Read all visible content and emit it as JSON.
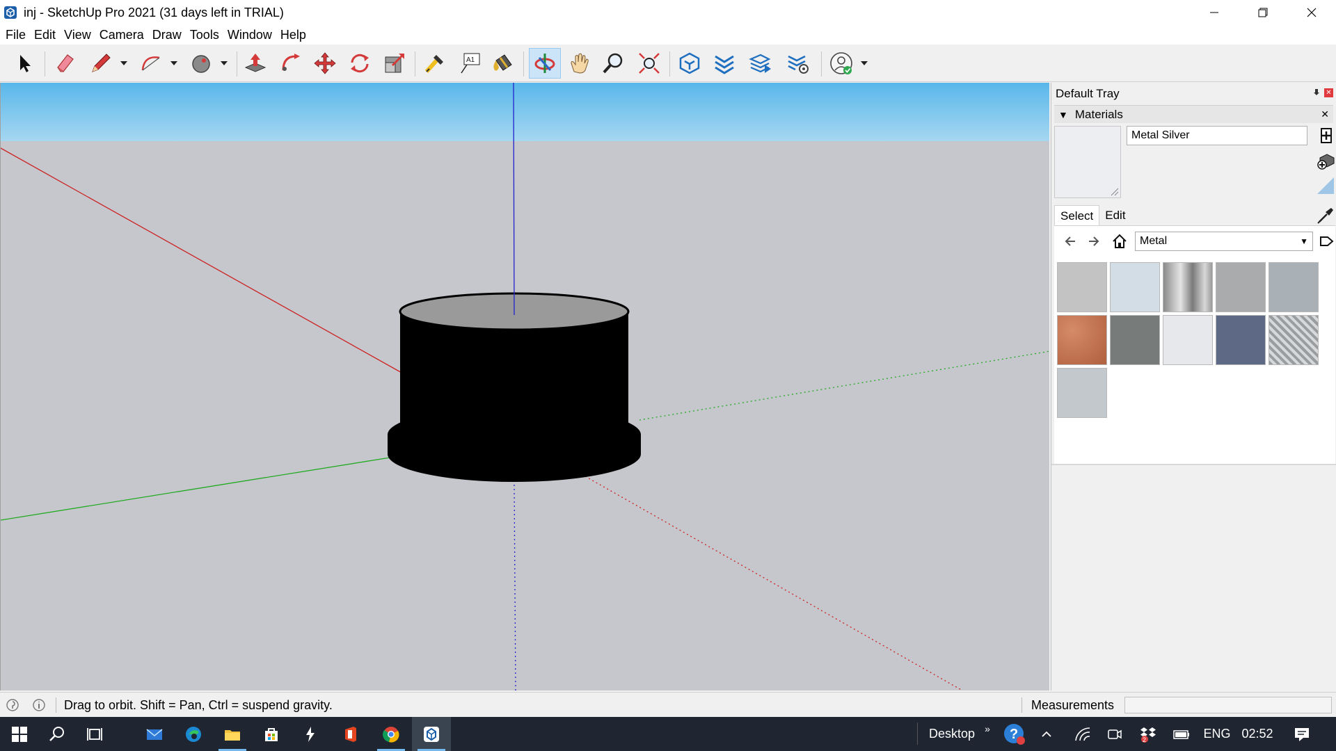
{
  "window": {
    "title": "inj - SketchUp Pro 2021 (31 days left in TRIAL)",
    "app_icon": "sketchup-icon",
    "controls": [
      "minimize-icon",
      "restore-icon",
      "close-icon"
    ]
  },
  "menu": [
    "File",
    "Edit",
    "View",
    "Camera",
    "Draw",
    "Tools",
    "Window",
    "Help"
  ],
  "toolbar": {
    "tools": [
      "select",
      "eraser",
      "line",
      "arc",
      "shapes",
      "push-pull",
      "follow-me",
      "move",
      "rotate",
      "scale",
      "tape-measure",
      "text",
      "paint-bucket",
      "orbit",
      "pan",
      "zoom",
      "zoom-extents",
      "3d-warehouse",
      "extension-warehouse",
      "layout",
      "extension-manager",
      "profile"
    ],
    "active_tool": "orbit"
  },
  "viewport": {
    "sky_color": "#6cc0ec",
    "ground_color": "#c6c7cc",
    "model_color": "#000000",
    "top_face_color": "#9a9a9a",
    "axis_colors": {
      "red": "#cc2222",
      "green": "#22aa22",
      "blue": "#2222cc"
    }
  },
  "tray": {
    "title": "Default Tray",
    "panel": "Materials",
    "material_name": "Metal Silver",
    "tabs": [
      "Select",
      "Edit"
    ],
    "active_tab": "Select",
    "library": "Metal",
    "swatch_colors": [
      "#c3c3c3",
      "#d3dde6",
      "#b8b8b8",
      "#a9abad",
      "#a9b1b6",
      "#c07555",
      "#777b7a",
      "#e7e8ec",
      "#5e6a85",
      "#b9bcbf",
      "#c3c8cc"
    ]
  },
  "status": {
    "hint": "Drag to orbit. Shift = Pan, Ctrl = suspend gravity.",
    "measurements_label": "Measurements",
    "measurements_value": ""
  },
  "taskbar": {
    "apps": [
      "start",
      "search",
      "task-view",
      "mail",
      "edge",
      "file-explorer",
      "store",
      "app",
      "office",
      "chrome",
      "sketchup"
    ],
    "desktop_label": "Desktop",
    "language": "ENG",
    "time": "02:52",
    "badge_count": "2"
  }
}
